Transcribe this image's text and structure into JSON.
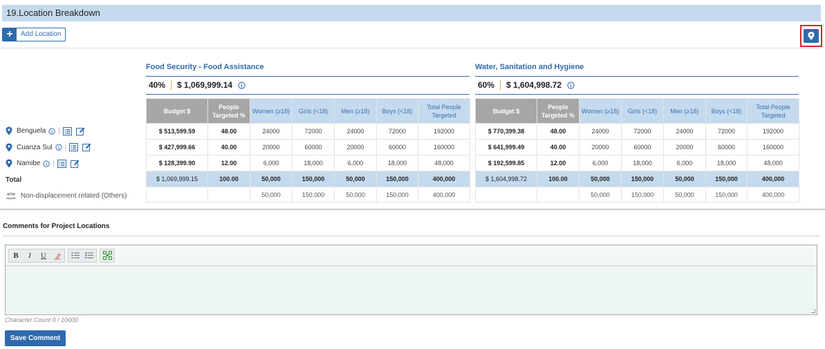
{
  "section": {
    "title": "19.Location Breakdown"
  },
  "add_location": {
    "plus": "+",
    "label": "Add Location"
  },
  "map_button": {
    "icon": "map-pin-icon"
  },
  "clusters": [
    {
      "name": "Food Security - Food Assistance",
      "percent": "40%",
      "amount": "$ 1,069,999.14",
      "columns": [
        "Budget $",
        "People Targeted %",
        "Women (≥18)",
        "Girls (<18)",
        "Men (≥18)",
        "Boys (<18)",
        "Total People Targeted"
      ],
      "rows": [
        [
          "$ 513,599.59",
          "48.00",
          "24000",
          "72000",
          "24000",
          "72000",
          "192000"
        ],
        [
          "$ 427,999.66",
          "40.00",
          "20000",
          "60000",
          "20000",
          "60000",
          "160000"
        ],
        [
          "$ 128,399.90",
          "12.00",
          "6,000",
          "18,000",
          "6,000",
          "18,000",
          "48,000"
        ]
      ],
      "total": [
        "$ 1,069,999.15",
        "100.00",
        "50,000",
        "150,000",
        "50,000",
        "150,000",
        "400,000"
      ],
      "nondisp": [
        "",
        "",
        "50,000",
        "150,000",
        "50,000",
        "150,000",
        "400,000"
      ]
    },
    {
      "name": "Water, Sanitation and Hygiene",
      "percent": "60%",
      "amount": "$ 1,604,998.72",
      "columns": [
        "Budget $",
        "People Targeted %",
        "Women (≥18)",
        "Girls (<18)",
        "Men (≥18)",
        "Boys (<18)",
        "Total People Targeted"
      ],
      "rows": [
        [
          "$ 770,399.38",
          "48.00",
          "24000",
          "72000",
          "24000",
          "72000",
          "192000"
        ],
        [
          "$ 641,999.49",
          "40.00",
          "20000",
          "60000",
          "20000",
          "60000",
          "160000"
        ],
        [
          "$ 192,599.85",
          "12.00",
          "6,000",
          "18,000",
          "6,000",
          "18,000",
          "48,000"
        ]
      ],
      "total": [
        "$ 1,604,998.72",
        "100.00",
        "50,000",
        "150,000",
        "50,000",
        "150,000",
        "400,000"
      ],
      "nondisp": [
        "",
        "",
        "50,000",
        "150,000",
        "50,000",
        "150,000",
        "400,000"
      ]
    }
  ],
  "locations": [
    {
      "name": "Benguela"
    },
    {
      "name": "Cuanza Sul"
    },
    {
      "name": "Namibe"
    }
  ],
  "total_label": "Total",
  "nondisp_label": "Non-displacement related (Others)",
  "comments": {
    "title": "Comments for Project Locations",
    "toolbar": {
      "bold": "B",
      "italic": "I",
      "underline": "U"
    },
    "char_count": "Character Count 0 / 10000",
    "save_label": "Save Comment"
  },
  "colors": {
    "accent": "#2f6aad",
    "header_bg": "#c5daee",
    "highlight_border": "#d9232e"
  }
}
